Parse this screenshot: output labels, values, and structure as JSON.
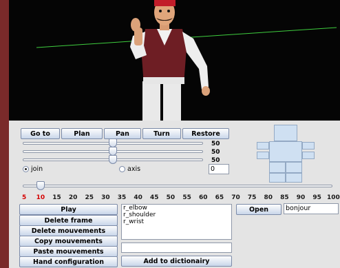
{
  "toolbar": {
    "goto_label": "Go to",
    "plan_label": "Plan",
    "pan_label": "Pan",
    "turn_label": "Turn",
    "restore_label": "Restore"
  },
  "sliders": [
    {
      "value": 50,
      "value_label": "50"
    },
    {
      "value": 50,
      "value_label": "50"
    },
    {
      "value": 50,
      "value_label": "50"
    }
  ],
  "mode": {
    "join_label": "join",
    "axis_label": "axis",
    "selected": "join",
    "field_value": "0"
  },
  "speed_slider": {
    "value": 10
  },
  "ticks": {
    "labels": [
      "5",
      "10",
      "15",
      "20",
      "25",
      "30",
      "35",
      "40",
      "45",
      "50",
      "55",
      "60",
      "65",
      "70",
      "75",
      "80",
      "85",
      "90",
      "95",
      "100"
    ],
    "highlight_color": "#d40000",
    "normal_color": "#1a1a1a"
  },
  "actions": {
    "play_label": "Play",
    "delete_frame_label": "Delete frame",
    "delete_mouvements_label": "Delete mouvements",
    "copy_mouvements_label": "Copy mouvements",
    "paste_mouvements_label": "Paste mouvements",
    "hand_configuration_label": "Hand configuration",
    "add_dictionary_label": "Add to dictionairy"
  },
  "joints": [
    "r_elbow",
    "r_shoulder",
    "r_wrist"
  ],
  "open": {
    "button_label": "Open",
    "field_value": "bonjour"
  },
  "viewport": {
    "background": "#050505",
    "ground_line_color": "#3fcf3f"
  }
}
